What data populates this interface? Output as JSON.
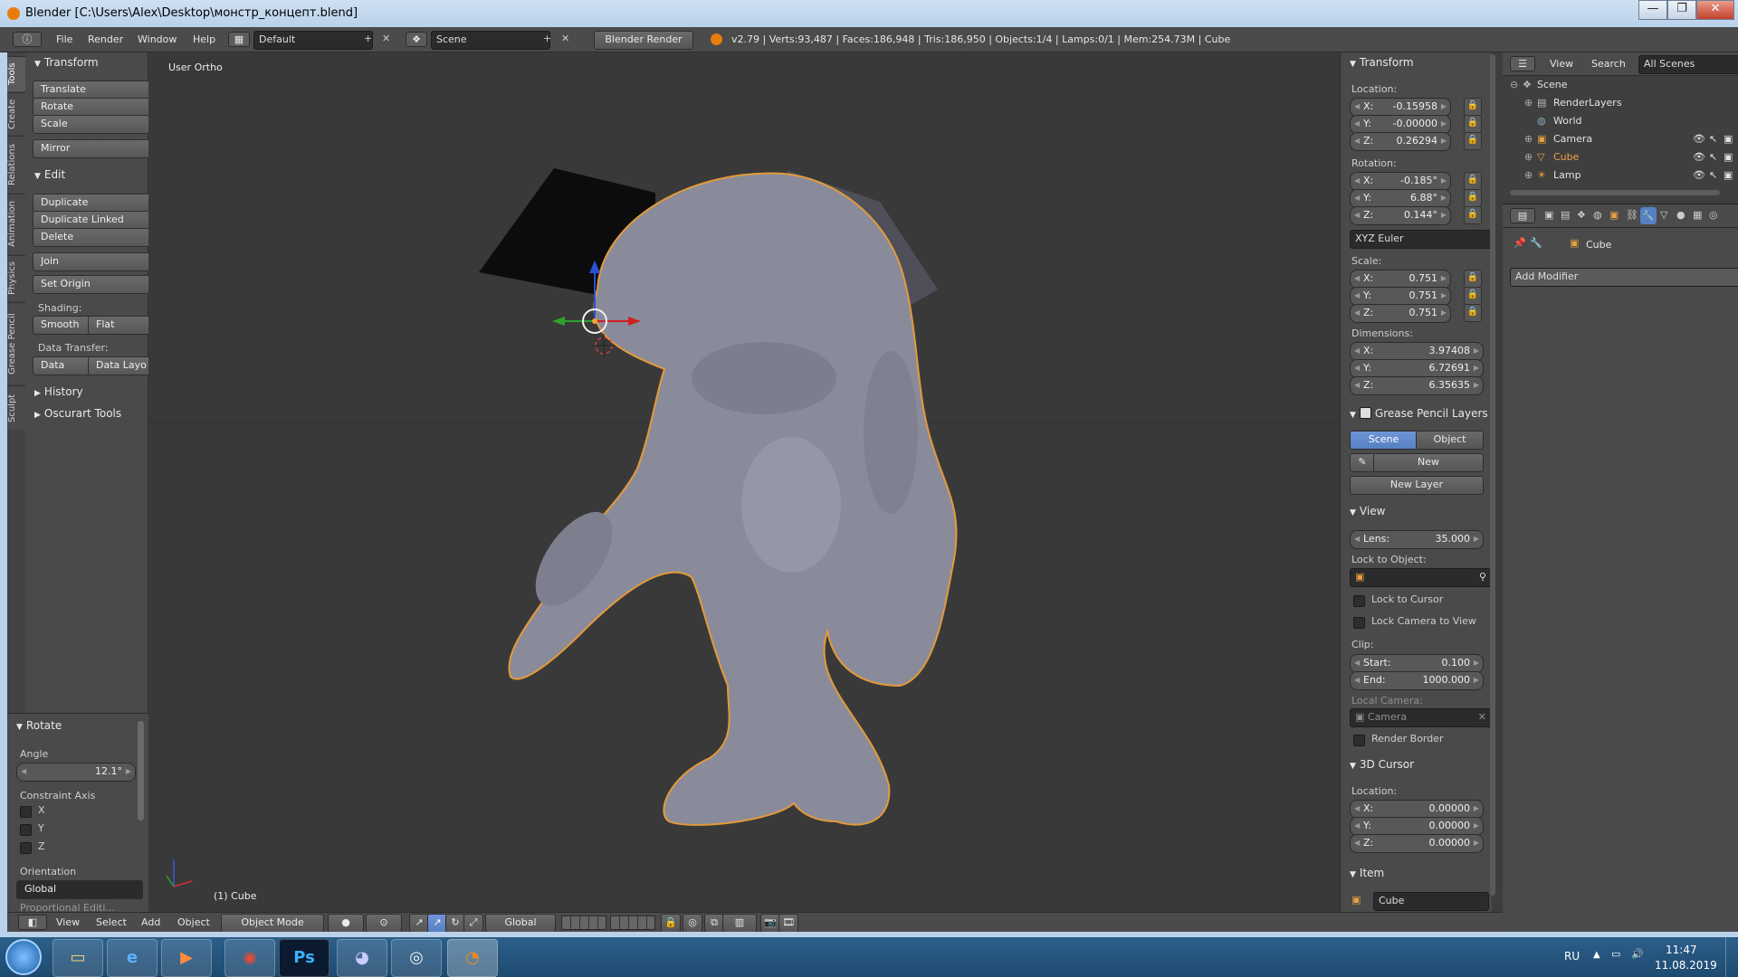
{
  "window": {
    "title": "Blender [C:\\Users\\Alex\\Desktop\\монстр_концепт.blend]",
    "controls": [
      "—",
      "❐",
      "✕"
    ]
  },
  "top_bar": {
    "menus": [
      "File",
      "Render",
      "Window",
      "Help"
    ],
    "layout_value": "Default",
    "scene_value": "Scene",
    "engine_value": "Blender Render",
    "stats": "v2.79 | Verts:93,487 | Faces:186,948 | Tris:186,950 | Objects:1/4 | Lamps:0/1 | Mem:254.73M | Cube"
  },
  "tabs": [
    "Tools",
    "Create",
    "Relations",
    "Animation",
    "Physics",
    "Grease Pencil",
    "Sculpt"
  ],
  "tool_shelf": {
    "transform_header": "Transform",
    "transform_buttons": [
      "Translate",
      "Rotate",
      "Scale"
    ],
    "mirror_label": "Mirror",
    "edit_header": "Edit",
    "edit_buttons": [
      "Duplicate",
      "Duplicate Linked",
      "Delete"
    ],
    "join_label": "Join",
    "set_origin_label": "Set Origin",
    "shading_label": "Shading:",
    "smooth_label": "Smooth",
    "flat_label": "Flat",
    "data_transfer_label": "Data Transfer:",
    "data_label": "Data",
    "data_layout_label": "Data Layo",
    "history_header": "History",
    "oscurart_header": "Oscurart Tools"
  },
  "operator_panel": {
    "header": "Rotate",
    "angle_label": "Angle",
    "angle_value": "12.1°",
    "constraint_label": "Constraint Axis",
    "axes": [
      "X",
      "Y",
      "Z"
    ],
    "orientation_label": "Orientation",
    "orientation_value": "Global",
    "cut_label": "Proportional Editi..."
  },
  "viewport": {
    "view_label": "User Ortho",
    "object_label": "(1) Cube"
  },
  "n_panel": {
    "transform_header": "Transform",
    "location_label": "Location:",
    "location": [
      {
        "k": "X:",
        "v": "-0.15958"
      },
      {
        "k": "Y:",
        "v": "-0.00000"
      },
      {
        "k": "Z:",
        "v": "0.26294"
      }
    ],
    "rotation_label": "Rotation:",
    "rotation": [
      {
        "k": "X:",
        "v": "-0.185°"
      },
      {
        "k": "Y:",
        "v": "6.88°"
      },
      {
        "k": "Z:",
        "v": "0.144°"
      }
    ],
    "rotation_mode": "XYZ Euler",
    "scale_label": "Scale:",
    "scale": [
      {
        "k": "X:",
        "v": "0.751"
      },
      {
        "k": "Y:",
        "v": "0.751"
      },
      {
        "k": "Z:",
        "v": "0.751"
      }
    ],
    "dimensions_label": "Dimensions:",
    "dimensions": [
      {
        "k": "X:",
        "v": "3.97408"
      },
      {
        "k": "Y:",
        "v": "6.72691"
      },
      {
        "k": "Z:",
        "v": "6.35635"
      }
    ],
    "grease_header": "Grease Pencil Layers",
    "scene_btn": "Scene",
    "object_btn": "Object",
    "new_btn": "New",
    "new_layer_btn": "New Layer",
    "view_header": "View",
    "lens_label": "Lens:",
    "lens_value": "35.000",
    "lock_object_label": "Lock to Object:",
    "lock_cursor_label": "Lock to Cursor",
    "lock_camera_label": "Lock Camera to View",
    "clip_label": "Clip:",
    "clip_start_label": "Start:",
    "clip_start_value": "0.100",
    "clip_end_label": "End:",
    "clip_end_value": "1000.000",
    "local_camera_label": "Local Camera:",
    "camera_value": "Camera",
    "render_border_label": "Render Border",
    "cursor_header": "3D Cursor",
    "cursor_location_label": "Location:",
    "cursor": [
      {
        "k": "X:",
        "v": "0.00000"
      },
      {
        "k": "Y:",
        "v": "0.00000"
      },
      {
        "k": "Z:",
        "v": "0.00000"
      }
    ],
    "item_header": "Item",
    "item_name": "Cube"
  },
  "outliner": {
    "view_menu": "View",
    "search_menu": "Search",
    "scenes_dropdown": "All Scenes",
    "items": [
      "Scene",
      "RenderLayers",
      "World",
      "Camera",
      "Cube",
      "Lamp"
    ]
  },
  "properties": {
    "object_name": "Cube",
    "add_modifier": "Add Modifier"
  },
  "view_header": {
    "menus": [
      "View",
      "Select",
      "Add",
      "Object"
    ],
    "mode_value": "Object Mode",
    "orientation_value": "Global"
  },
  "taskbar": {
    "apps": [
      "Explorer",
      "Internet Explorer",
      "Media Player",
      "Chrome",
      "Photoshop",
      "Discord",
      "OBS",
      "Blender"
    ],
    "ps_label": "Ps",
    "lang": "RU",
    "time": "11:47",
    "date": "11.08.2019"
  },
  "colors": {
    "selection_outline": "#e39a3b",
    "mesh": "#8b8d9c",
    "viewport_bg": "#393939",
    "accent_blue": "#5680c2"
  }
}
